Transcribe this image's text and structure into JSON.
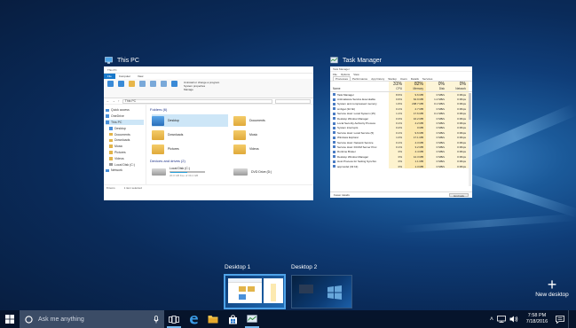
{
  "explorer_thumbnail": {
    "title": "This PC",
    "window_title": "This PC",
    "tabs": [
      "File",
      "Computer",
      "View"
    ],
    "ribbon_buttons": [
      "Properties",
      "Open",
      "Rename",
      "Access media",
      "Map network drive",
      "Add a network location",
      "Open Settings"
    ],
    "ribbon_side": [
      "Uninstall or change a program",
      "System properties",
      "Manage"
    ],
    "address": "This PC",
    "nav_items": [
      "Quick access",
      "OneDrive",
      "This PC",
      "Desktop",
      "Documents",
      "Downloads",
      "Music",
      "Pictures",
      "Videos",
      "Local Disk (C:)",
      "Network"
    ],
    "folders_heading": "Folders (6)",
    "folders": [
      "Desktop",
      "Documents",
      "Downloads",
      "Music",
      "Pictures",
      "Videos"
    ],
    "devices_heading": "Devices and drives (2)",
    "drives": [
      {
        "name": "Local Disk (C:)",
        "detail": "20.0 GB free of 39.4 GB"
      },
      {
        "name": "DVD Drive (D:)",
        "detail": ""
      }
    ],
    "status_items": "8 items",
    "status_selected": "1 item selected"
  },
  "taskmanager_thumbnail": {
    "title": "Task Manager",
    "window_title": "Task Manager",
    "menu": [
      "File",
      "Options",
      "View"
    ],
    "tabs": [
      "Processes",
      "Performance",
      "App history",
      "Startup",
      "Users",
      "Details",
      "Services"
    ],
    "columns": [
      {
        "pct": "",
        "label": "Name"
      },
      {
        "pct": "31%",
        "label": "CPU"
      },
      {
        "pct": "82%",
        "label": "Memory"
      },
      {
        "pct": "0%",
        "label": "Disk"
      },
      {
        "pct": "0%",
        "label": "Network"
      }
    ],
    "rows": [
      {
        "name": "Task Manager",
        "cpu": "8.6%",
        "mem": "9.6 MB",
        "disk": "0 MB/s",
        "net": "0 Mbps"
      },
      {
        "name": "Antimalware Service Executable",
        "cpu": "0.6%",
        "mem": "64.9 MB",
        "disk": "1.2 MB/s",
        "net": "0 Mbps"
      },
      {
        "name": "System and compressed memory",
        "cpu": "1.6%",
        "mem": "208.7 MB",
        "disk": "0.1 MB/s",
        "net": "0 Mbps"
      },
      {
        "name": "smbget (32 bit)",
        "cpu": "0.1%",
        "mem": "2.7 MB",
        "disk": "0 MB/s",
        "net": "0 Mbps"
      },
      {
        "name": "Service Host: Local System (15)",
        "cpu": "1.1%",
        "mem": "17.6 MB",
        "disk": "0.1 MB/s",
        "net": "0 Mbps"
      },
      {
        "name": "Desktop Window Manager",
        "cpu": "0.3%",
        "mem": "16.2 MB",
        "disk": "0 MB/s",
        "net": "0 Mbps"
      },
      {
        "name": "Local Security Authority Process",
        "cpu": "0.1%",
        "mem": "4.2 MB",
        "disk": "0 MB/s",
        "net": "0 Mbps"
      },
      {
        "name": "System interrupts",
        "cpu": "0.2%",
        "mem": "0 MB",
        "disk": "0 MB/s",
        "net": "0 Mbps"
      },
      {
        "name": "Service Host: Local Service (5)",
        "cpu": "0.1%",
        "mem": "9.6 MB",
        "disk": "0 MB/s",
        "net": "0 Mbps"
      },
      {
        "name": "Windows Explorer",
        "cpu": "1.0%",
        "mem": "17.1 MB",
        "disk": "0 MB/s",
        "net": "0 Mbps"
      },
      {
        "name": "Service Host: Network Service",
        "cpu": "0.1%",
        "mem": "4.3 MB",
        "disk": "0 MB/s",
        "net": "0 Mbps"
      },
      {
        "name": "Service Host: DCOM Server Proc",
        "cpu": "0.1%",
        "mem": "3.2 MB",
        "disk": "0 MB/s",
        "net": "0 Mbps"
      },
      {
        "name": "Runtime Broker",
        "cpu": "0%",
        "mem": "4.4 MB",
        "disk": "0 MB/s",
        "net": "0 Mbps"
      },
      {
        "name": "Desktop Window Manager",
        "cpu": "0%",
        "mem": "12.3 MB",
        "disk": "0 MB/s",
        "net": "0 Mbps"
      },
      {
        "name": "Host Process for Setting Synchro",
        "cpu": "0%",
        "mem": "1.1 MB",
        "disk": "0 MB/s",
        "net": "0 Mbps"
      },
      {
        "name": "appmodel (32 bit)",
        "cpu": "0%",
        "mem": "1.3 MB",
        "disk": "0 MB/s",
        "net": "0 Mbps"
      }
    ],
    "fewer_details": "Fewer details",
    "end_task": "End task"
  },
  "desktops": [
    {
      "label": "Desktop 1",
      "active": true
    },
    {
      "label": "Desktop 2",
      "active": false
    }
  ],
  "new_desktop": {
    "label": "New desktop"
  },
  "taskbar": {
    "search_placeholder": "Ask me anything",
    "icons": [
      "task-view-icon",
      "edge-icon",
      "file-explorer-icon",
      "store-icon",
      "task-manager-icon"
    ],
    "time": "7:58 PM",
    "date": "7/18/2016"
  },
  "colors": {
    "accent": "#1979ca",
    "taskbar": "#06122a",
    "search": "#3b4c66",
    "active_desktop": "#4fa3e8",
    "cpu_heat": "#fce9b0"
  }
}
